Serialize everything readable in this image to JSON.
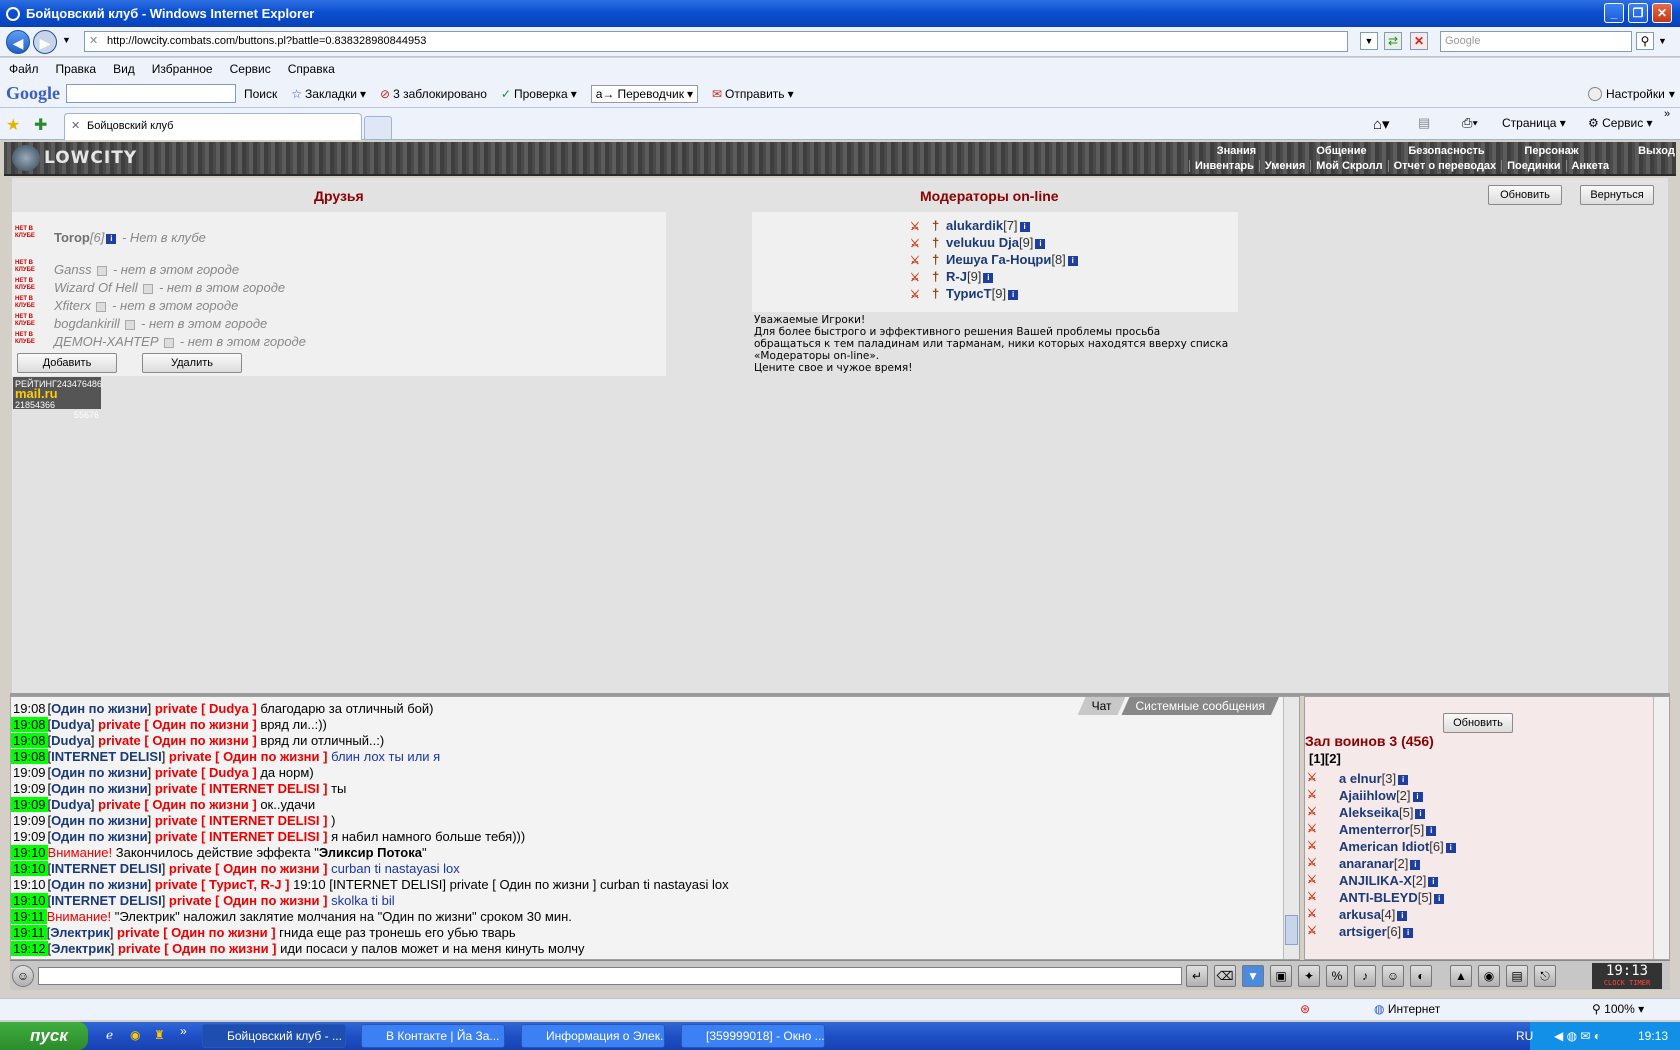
{
  "window": {
    "title": "Бойцовский клуб - Windows Internet Explorer",
    "address": "http://lowcity.combats.com/buttons.pl?battle=0.838328980844953",
    "search_placeholder": "Google"
  },
  "menu": [
    "Файл",
    "Правка",
    "Вид",
    "Избранное",
    "Сервис",
    "Справка"
  ],
  "googlebar": {
    "logo": "Google",
    "search": "Поиск",
    "bookmarks": "Закладки",
    "blocked": "3 заблокировано",
    "check": "Проверка",
    "translator": "Переводчик",
    "send": "Отправить",
    "settings": "Настройки"
  },
  "tab": {
    "label": "Бойцовский клуб"
  },
  "tools": {
    "page": "Страница",
    "service": "Сервис"
  },
  "game": {
    "logo": "LOWCITY",
    "nav_top": [
      "Знания",
      "Общение",
      "Безопасность",
      "Персонаж",
      "Выход"
    ],
    "nav_bottom": [
      "Инвентарь",
      "Умения",
      "Мой Скролл",
      "Отчет о переводах",
      "Поединки",
      "Анкета"
    ],
    "friends_title": "Друзья",
    "moderators_title": "Модераторы on-line",
    "refresh": "Обновить",
    "back": "Вернуться",
    "add": "Добавить",
    "delete": "Удалить",
    "stamp": "НЕТ В КЛУБЕ",
    "friends": [
      {
        "name": "Torop",
        "level": "[6]",
        "status": "- Нет в клубе"
      },
      {
        "name": "Ganss",
        "level": "",
        "status": "- нет в этом городе"
      },
      {
        "name": "Wizard Of Hell",
        "level": "",
        "status": "- нет в этом городе"
      },
      {
        "name": "Xfiterx",
        "level": "",
        "status": "- нет в этом городе"
      },
      {
        "name": "bogdankirill",
        "level": "",
        "status": "- нет в этом городе"
      },
      {
        "name": "ДЕМОН-ХАНТЕР",
        "level": "",
        "status": "- нет в этом городе"
      }
    ],
    "moderators": [
      {
        "name": "alukardik",
        "level": "[7]"
      },
      {
        "name": "velukuu Dja",
        "level": "[9]"
      },
      {
        "name": "Иешуа Га-Ноцри",
        "level": "[8]"
      },
      {
        "name": "R-J",
        "level": "[9]"
      },
      {
        "name": "ТурисТ",
        "level": "[9]"
      }
    ],
    "notice": [
      "Уважаемые Игроки!",
      "Для более быстрого и эффективного решения Вашей проблемы просьба",
      "обращаться к тем паладинам или тарманам, ники которых находятся вверху списка",
      "«Модераторы on-line».",
      "Цените свое и чужое время!"
    ],
    "mailru": {
      "rating": "РЕЙТИНГ",
      "n1": "243476486",
      "brand": "mail.ru",
      "n2": "21854366",
      "n3": "55676"
    }
  },
  "chat": {
    "tabs": [
      "Чат",
      "Системные сообщения"
    ],
    "lines": [
      {
        "time": "19:08",
        "hl": false,
        "from": "Один по жизни",
        "to": "private [ Dudya ]",
        "text": "благодарю за отличный бой)",
        "color": "dark"
      },
      {
        "time": "19:08",
        "hl": true,
        "from": "Dudya",
        "to": "private [ Один по жизни ]",
        "text": "вряд ли..:))",
        "color": "dark"
      },
      {
        "time": "19:08",
        "hl": true,
        "from": "Dudya",
        "to": "private [ Один по жизни ]",
        "text": "вряд ли отличный..:)",
        "color": "dark"
      },
      {
        "time": "19:08",
        "hl": true,
        "from": "INTERNET DELISI",
        "to": "private [ Один по жизни ]",
        "text": "блин лох ты или я",
        "color": "blue"
      },
      {
        "time": "19:09",
        "hl": false,
        "from": "Один по жизни",
        "to": "private [ Dudya ]",
        "text": "да норм)",
        "color": "dark"
      },
      {
        "time": "19:09",
        "hl": false,
        "from": "Один по жизни",
        "to": "private [ INTERNET DELISI ]",
        "text": "ты",
        "color": "dark"
      },
      {
        "time": "19:09",
        "hl": true,
        "from": "Dudya",
        "to": "private [ Один по жизни ]",
        "text": "ок..удачи",
        "color": "dark"
      },
      {
        "time": "19:09",
        "hl": false,
        "from": "Один по жизни",
        "to": "private [ INTERNET DELISI ]",
        "text": ")",
        "color": "dark"
      },
      {
        "time": "19:09",
        "hl": false,
        "from": "Один по жизни",
        "to": "private [ INTERNET DELISI ]",
        "text": "я набил намного больше тебя)))",
        "color": "dark"
      },
      {
        "time": "19:10",
        "hl": true,
        "system": true,
        "attention": "Внимание!",
        "text": "Закончилось действие эффекта \"",
        "bold": "Эликсир Потока",
        "tail": "\""
      },
      {
        "time": "19:10",
        "hl": true,
        "from": "INTERNET DELISI",
        "to": "private [ Один по жизни ]",
        "text": "curban ti nastayasi lox",
        "color": "blue"
      },
      {
        "time": "19:10",
        "hl": false,
        "from": "Один по жизни",
        "to": "private [ ТурисТ, R-J ]",
        "text": "19:10 [INTERNET DELISI] private [ Один по жизни ] curban ti nastayasi lox",
        "color": "dark"
      },
      {
        "time": "19:10",
        "hl": true,
        "from": "INTERNET DELISI",
        "to": "private [ Один по жизни ]",
        "text": "skolka ti bil",
        "color": "blue"
      },
      {
        "time": "19:11",
        "hl": true,
        "system": true,
        "attention": "Внимание!",
        "text": "\"Электрик\" наложил заклятие молчания на \"Один по жизни\" сроком 30 мин.",
        "bold": "",
        "tail": ""
      },
      {
        "time": "19:11",
        "hl": true,
        "from": "Электрик",
        "to": "private [ Один по жизни ]",
        "text": "гнида еще раз тронешь его убью тварь",
        "color": "dark"
      },
      {
        "time": "19:12",
        "hl": true,
        "from": "Электрик",
        "to": "private [ Один по жизни ]",
        "text": "иди посаси у палов может и на меня кинуть молчу",
        "color": "dark"
      }
    ]
  },
  "side": {
    "refresh": "Обновить",
    "hall": "Зал воинов 3 (456)",
    "pages": "[1][2]",
    "players": [
      {
        "name": "a elnur",
        "level": "[3]"
      },
      {
        "name": "Ajaiihlow",
        "level": "[2]"
      },
      {
        "name": "Alekseika",
        "level": "[5]"
      },
      {
        "name": "Amenterror",
        "level": "[5]"
      },
      {
        "name": "American Idiot",
        "level": "[6]"
      },
      {
        "name": "anaranar",
        "level": "[2]"
      },
      {
        "name": "ANJILIKA-X",
        "level": "[2]"
      },
      {
        "name": "ANTI-BLEYD",
        "level": "[5]"
      },
      {
        "name": "arkusa",
        "level": "[4]"
      },
      {
        "name": "artsiger",
        "level": "[6]"
      }
    ]
  },
  "bottom": {
    "clock": "19:13",
    "clock_sub": "CLOCK TIMER"
  },
  "statusbar": {
    "zone": "Интернет",
    "zoom": "100%"
  },
  "taskbar": {
    "start": "пуск",
    "tasks": [
      "Бойцовский клуб - ...",
      "В Контакте | Йа За...",
      "Информация о Элек...",
      "[359999018] - Окно ..."
    ],
    "lang": "RU",
    "time": "19:13"
  }
}
